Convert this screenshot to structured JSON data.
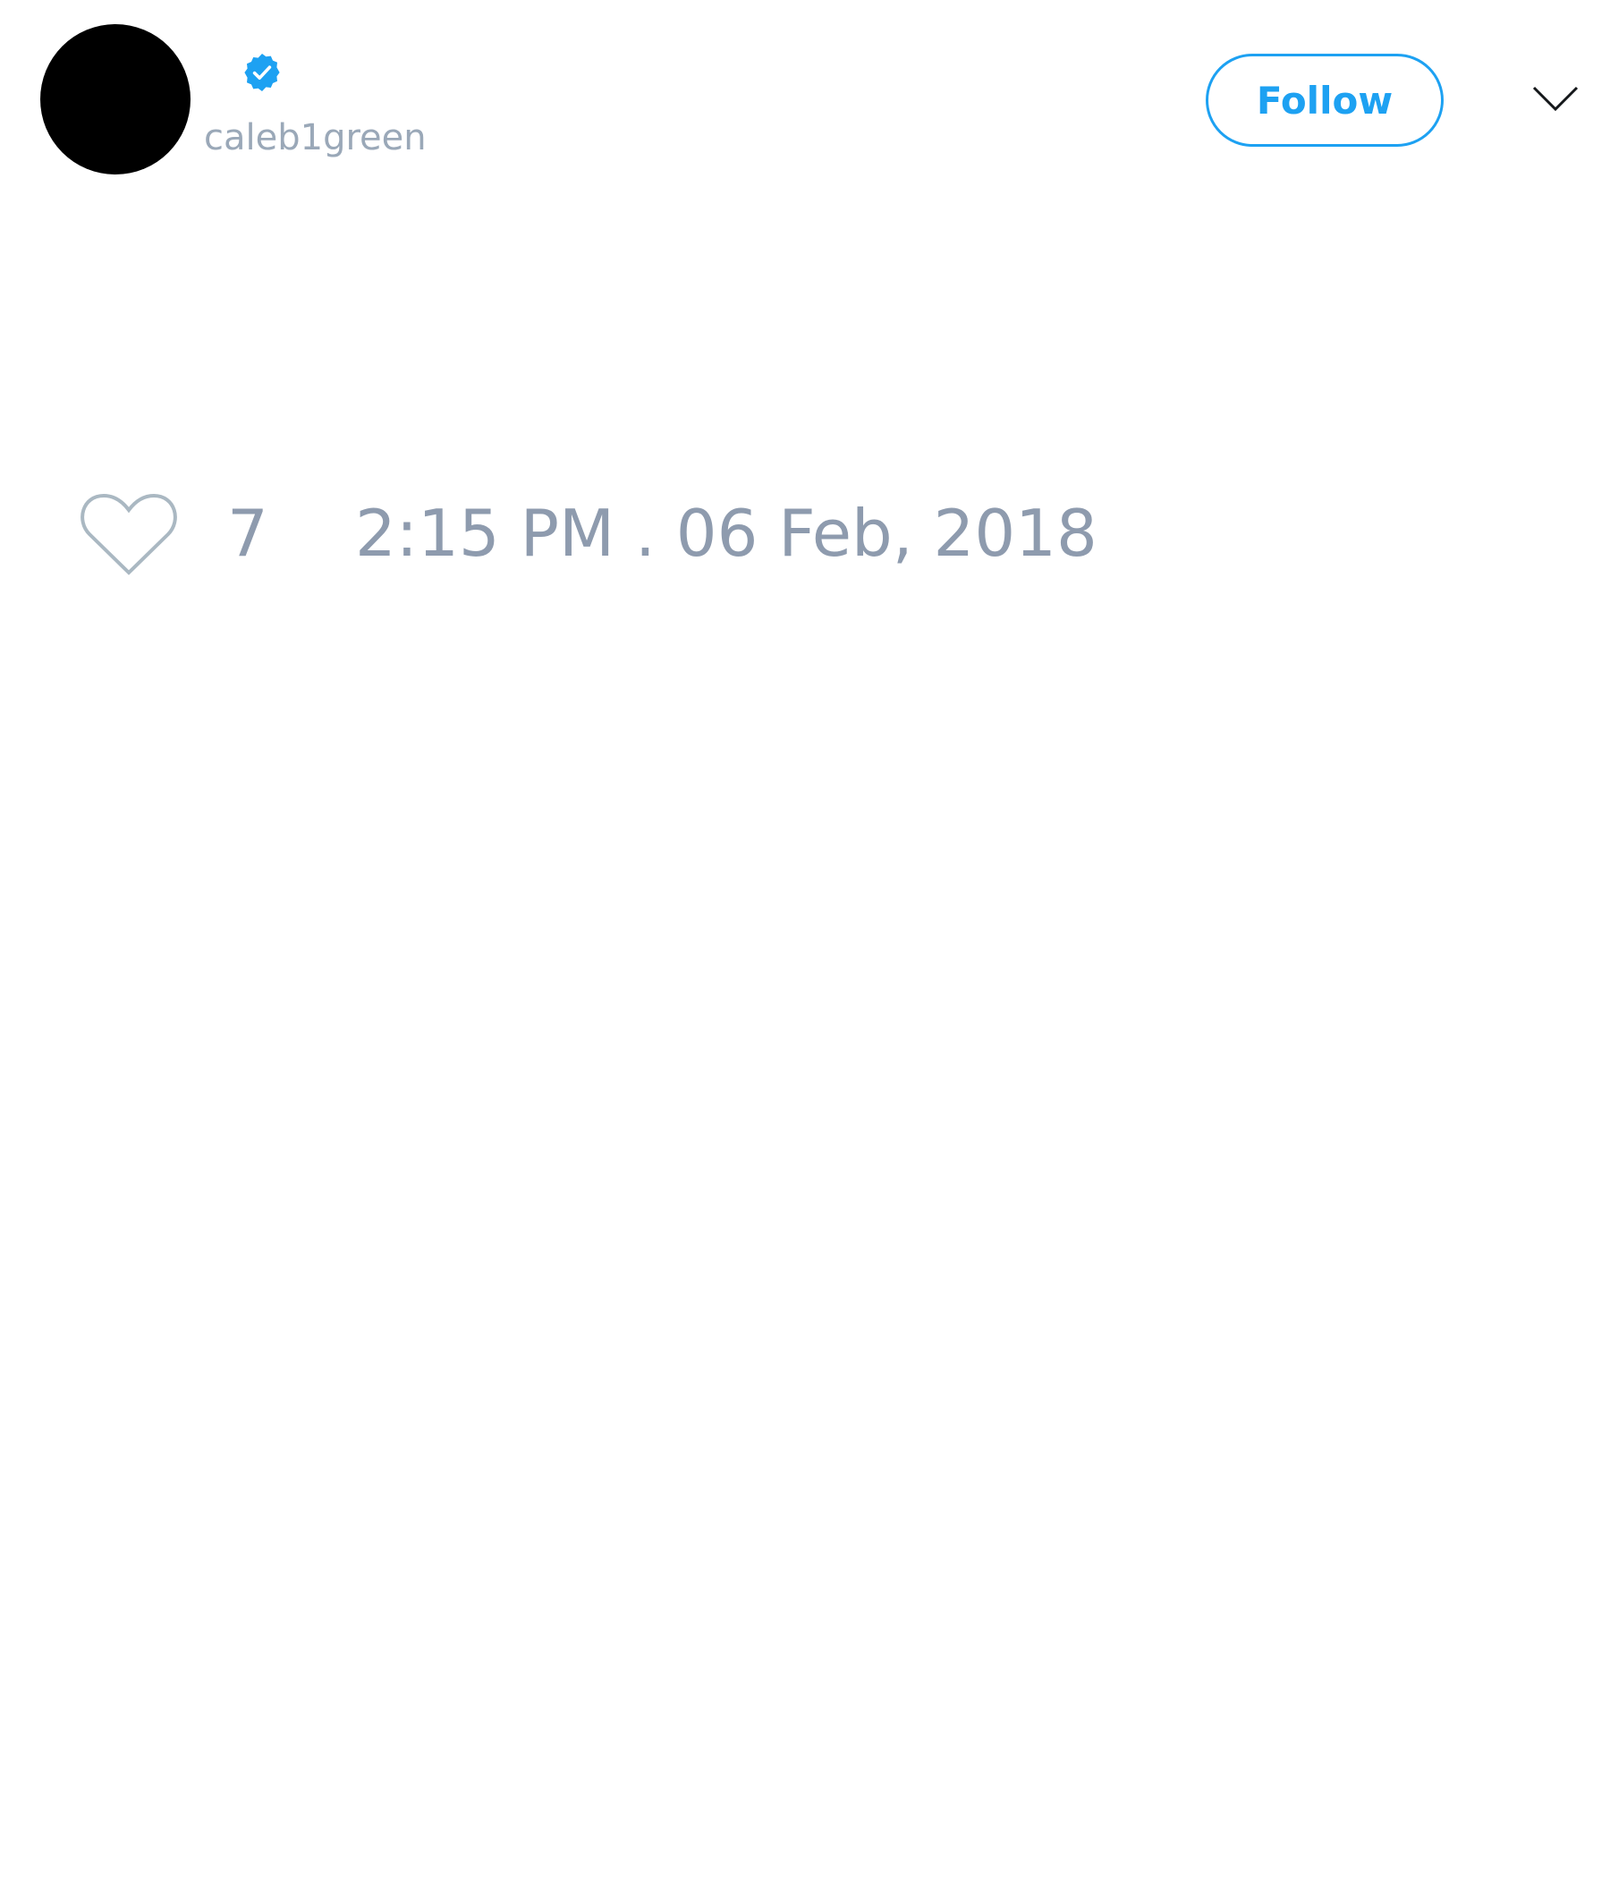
{
  "author": {
    "handle": "caleb1green",
    "verified": true
  },
  "header": {
    "follow_label": "Follow"
  },
  "tweet": {
    "like_count": "7",
    "timestamp": "2:15 PM . 06 Feb, 2018"
  },
  "icons": {
    "verified": "verified-badge-icon",
    "menu": "chevron-down-icon",
    "like": "heart-icon"
  },
  "colors": {
    "accent": "#1da1f2",
    "secondary_text": "#8e9bae",
    "background": "#ffffff",
    "avatar": "#000000"
  }
}
